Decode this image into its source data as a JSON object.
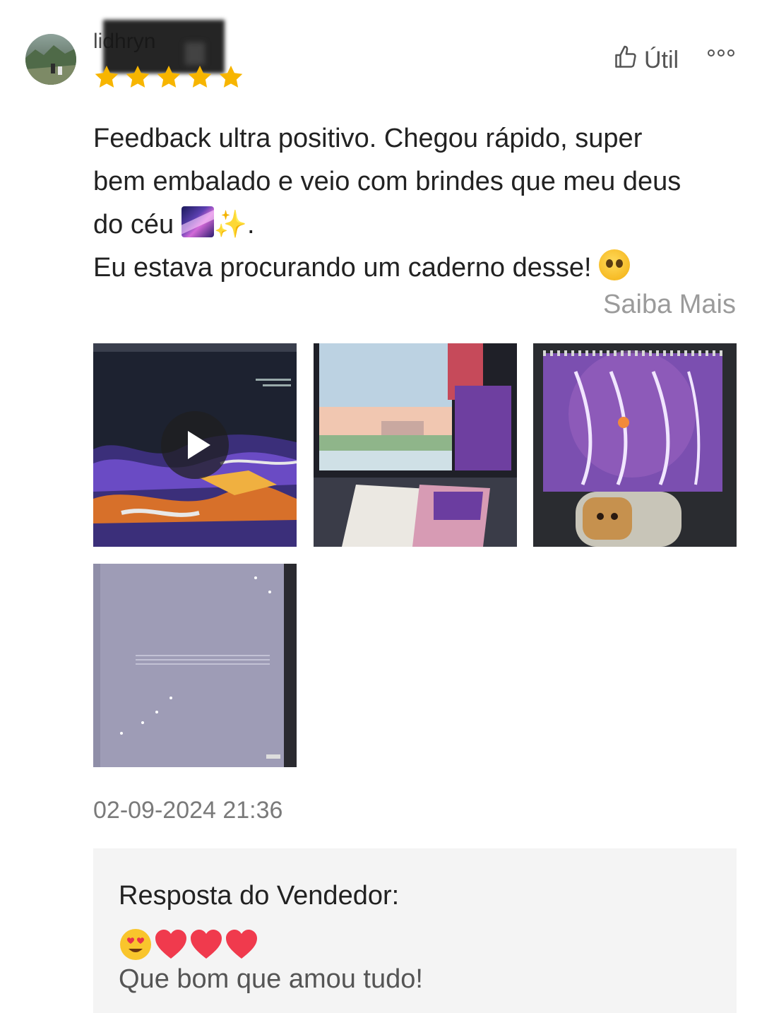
{
  "review": {
    "username": "lidhryn",
    "rating": 5,
    "useful_label": "Útil",
    "text_line1": "Feedback ultra positivo. Chegou rápido, super",
    "text_line2": "bem embalado e veio com brindes que meu deus",
    "text_line3": "do céu",
    "text_line3_end": ".",
    "text_line4": "Eu estava procurando um caderno desse!",
    "read_more": "Saiba Mais",
    "date": "02-09-2024 21:36"
  },
  "media": {
    "items": [
      {
        "type": "video",
        "icon": "play-icon"
      },
      {
        "type": "image"
      },
      {
        "type": "image"
      },
      {
        "type": "image"
      }
    ]
  },
  "seller": {
    "title": "Resposta do Vendedor:",
    "message": "Que bom que amou tudo!"
  },
  "colors": {
    "star": "#f7b500",
    "muted_text": "#9b9b9b",
    "reply_background": "#f4f4f4"
  }
}
